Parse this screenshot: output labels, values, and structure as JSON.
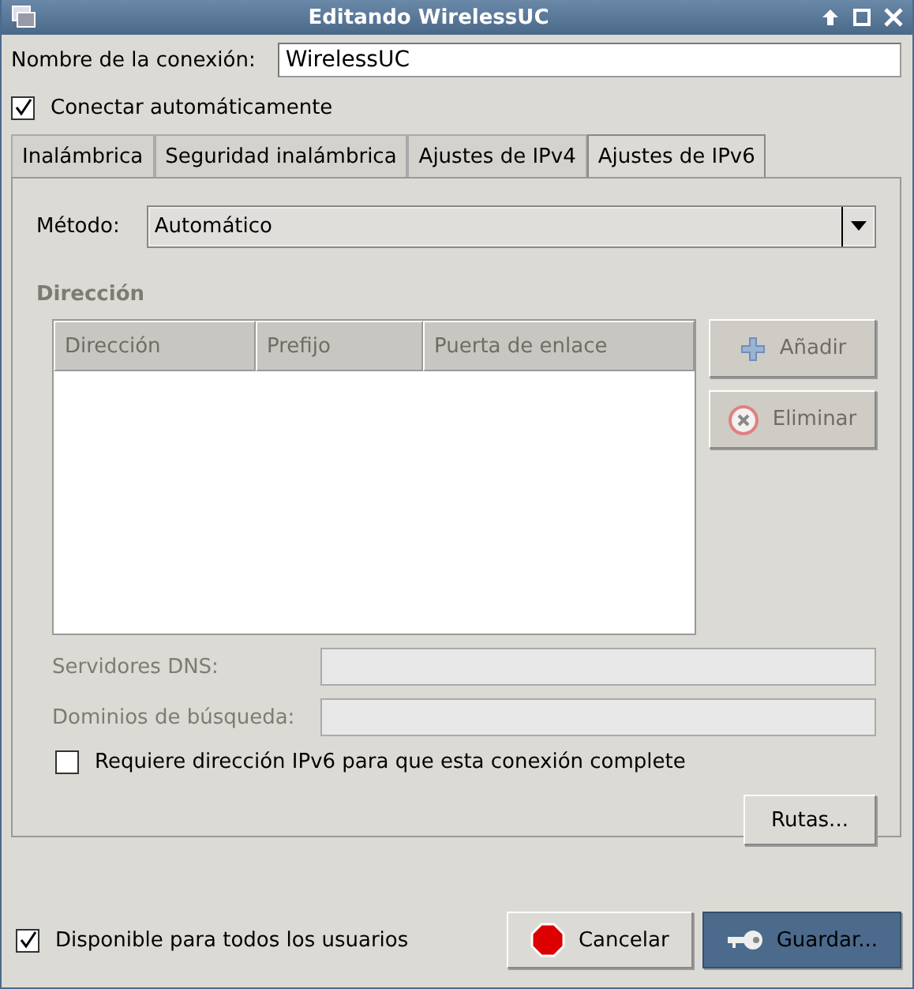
{
  "window": {
    "title": "Editando WirelessUC"
  },
  "connection_name": {
    "label": "Nombre de la conexión:",
    "value": "WirelessUC"
  },
  "auto_connect": {
    "label": "Conectar automáticamente",
    "checked": true
  },
  "tabs": [
    {
      "label": "Inalámbrica",
      "selected": false
    },
    {
      "label": "Seguridad inalámbrica",
      "selected": false
    },
    {
      "label": "Ajustes de IPv4",
      "selected": false
    },
    {
      "label": "Ajustes de IPv6",
      "selected": true
    }
  ],
  "method": {
    "label": "Método:",
    "value": "Automático"
  },
  "address_section": {
    "title": "Dirección",
    "disabled": true,
    "columns": [
      "Dirección",
      "Prefijo",
      "Puerta de enlace"
    ],
    "buttons": [
      {
        "label": "Añadir",
        "kind": "add",
        "disabled": true
      },
      {
        "label": "Eliminar",
        "kind": "remove",
        "disabled": true
      }
    ]
  },
  "dns": {
    "label": "Servidores DNS:",
    "disabled": true
  },
  "search_domains": {
    "label": "Dominios de búsqueda:",
    "disabled": true
  },
  "require_ipv6": {
    "label": "Requiere dirección IPv6 para que esta conexión complete",
    "checked": false
  },
  "routes_button": {
    "label": "Rutas..."
  },
  "available_all_users": {
    "label": "Disponible para todos los usuarios",
    "checked": true
  },
  "buttons": [
    {
      "label": "Cancelar",
      "kind": "cancel",
      "focused": false
    },
    {
      "label": "Guardar...",
      "kind": "save",
      "focused": true
    }
  ]
}
